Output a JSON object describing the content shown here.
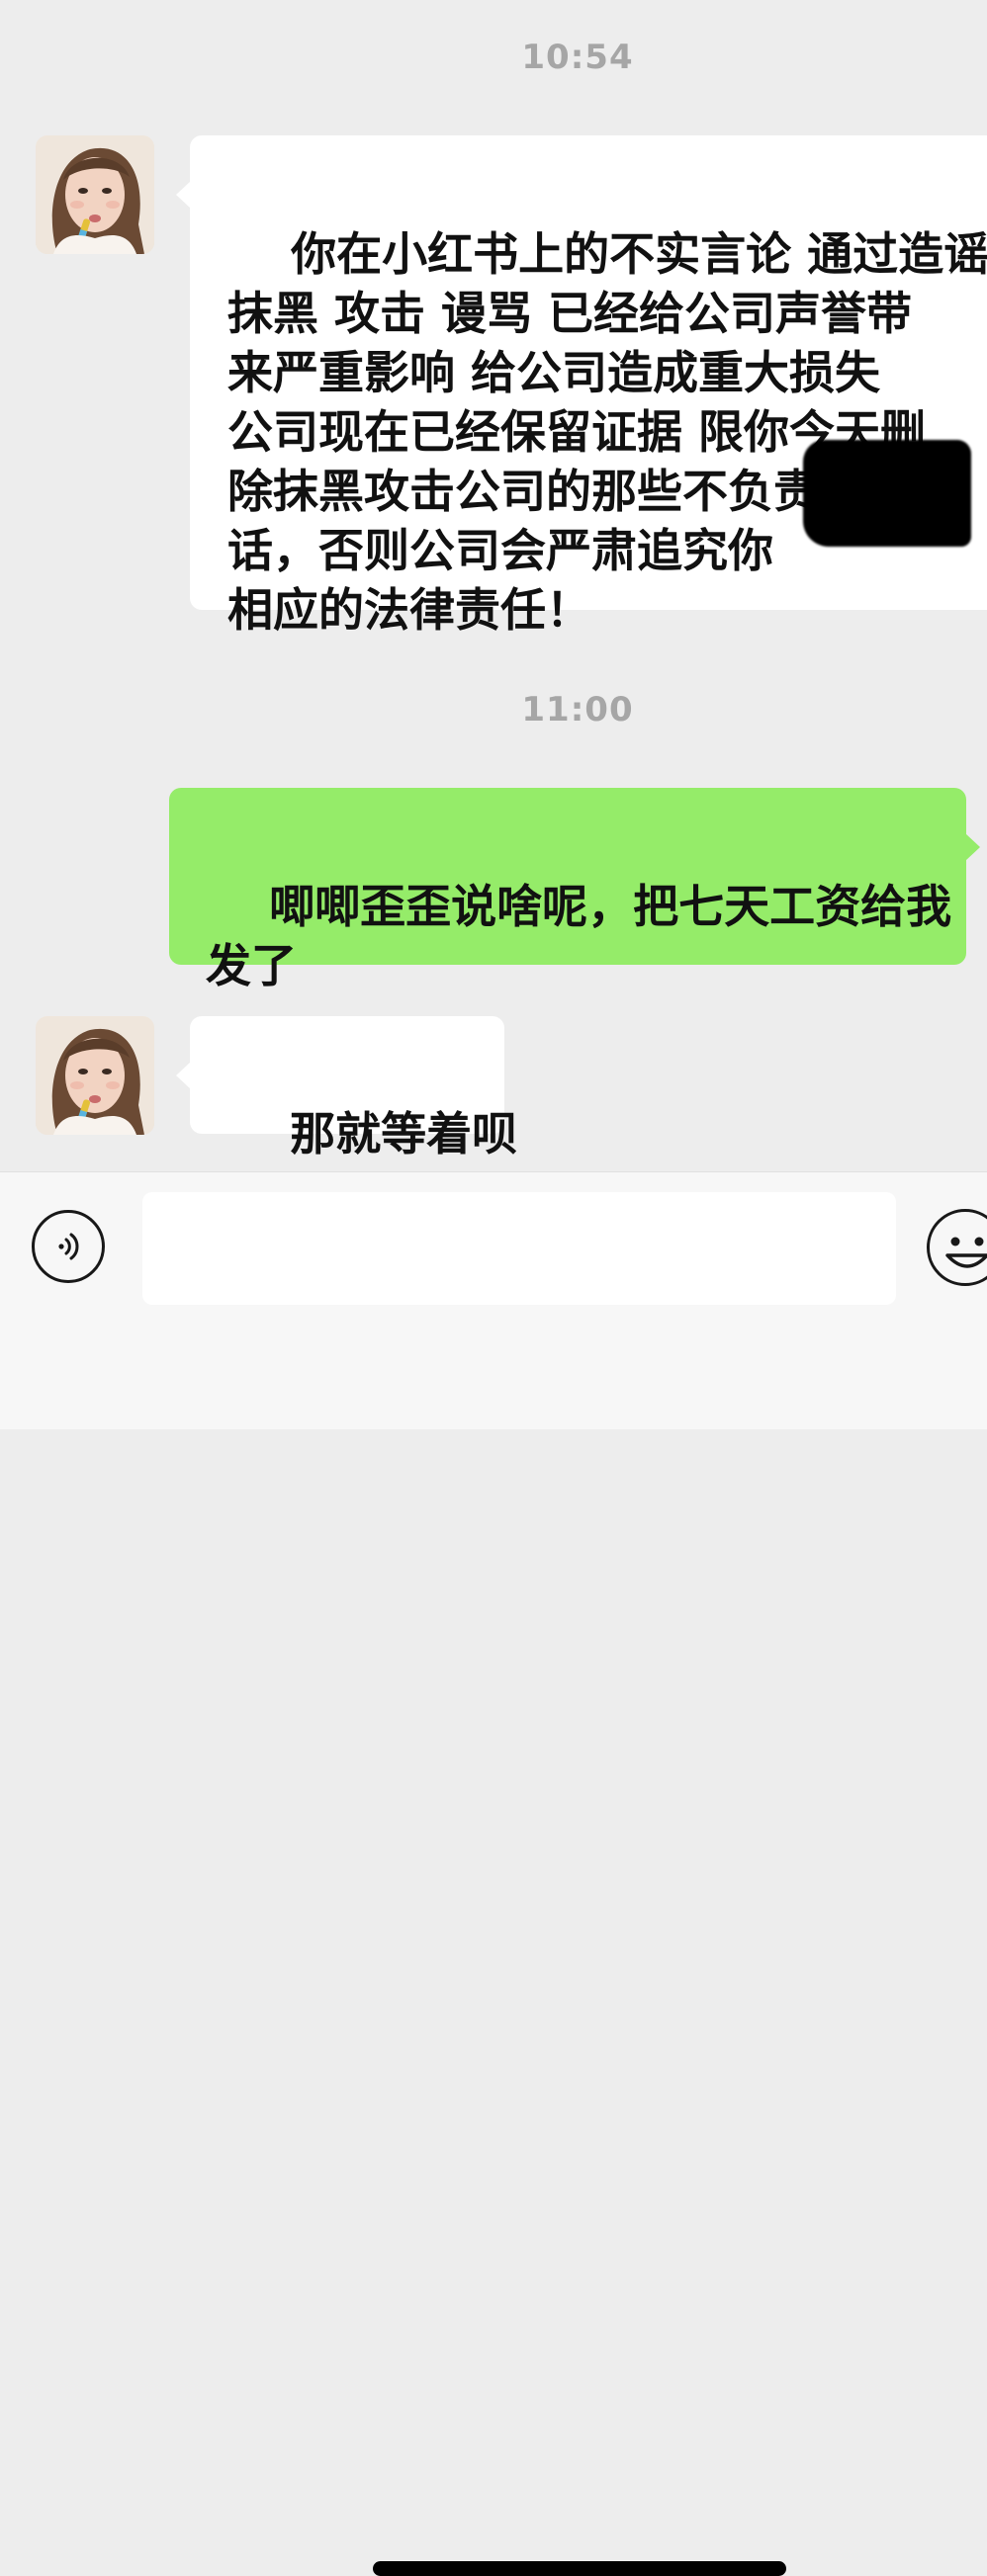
{
  "conversation": {
    "messages": [
      {
        "type": "timestamp",
        "text": "10:54"
      },
      {
        "type": "received",
        "sender_icon": "avatar",
        "text": "你在小红书上的不实言论 通过造谣\n抹黑 攻击 谩骂 已经给公司声誉带\n来严重影响 给公司造成重大损失\n公司现在已经保留证据 限你今天删\n除抹黑攻击公司的那些不负责任的\n话，否则公司会严肃追究你\n相应的法律责任！"
      },
      {
        "type": "timestamp",
        "text": "11:00"
      },
      {
        "type": "sent",
        "text": "唧唧歪歪说啥呢，把七天工资给我\n发了"
      },
      {
        "type": "received",
        "sender_icon": "avatar",
        "text": "那就等着呗"
      }
    ]
  },
  "input_bar": {
    "voice_icon": "voice-icon",
    "input_value": "",
    "emoji_icon": "emoji-icon"
  },
  "colors": {
    "background": "#ededed",
    "received_bubble": "#ffffff",
    "sent_bubble": "#95ec69",
    "timestamp_text": "#a6a6a6"
  }
}
